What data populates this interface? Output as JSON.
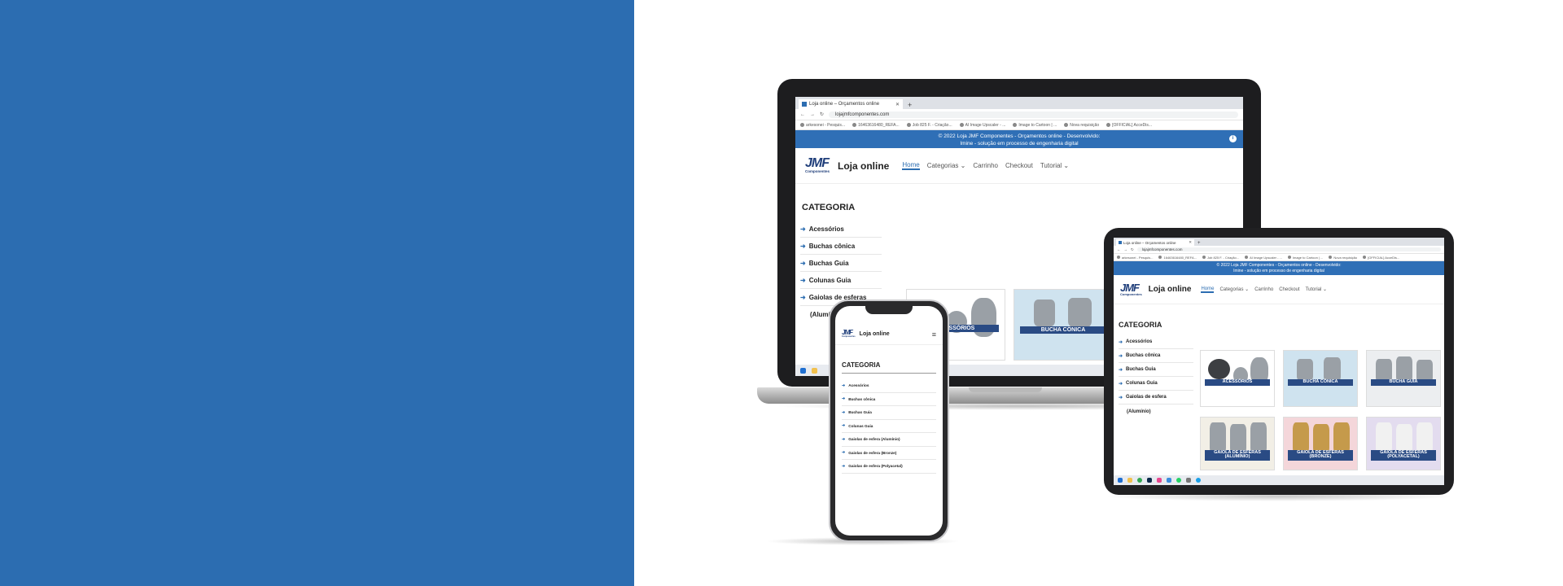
{
  "browser": {
    "tab_title": "Loja online – Orçamentos online",
    "tab_close": "✕",
    "new_tab": "+",
    "url": "lojajmfcomponentes.com",
    "bookmarks": [
      "arkesonei - Pesquis...",
      "16463616480_REFA...",
      "Job 825 F. - Criação...",
      "AI Image Upscaler - ...",
      "Image to Cartoon | ...",
      "Nova requisição",
      "[OFFICIAL] AcceDis..."
    ]
  },
  "site": {
    "banner_line1": "© 2022 Loja JMF Componentes - Orçamentos online - Desenvolvido:",
    "banner_line2": "Imine - solução em processo de engenharia digital",
    "banner_icon": "i",
    "logo_mark": "JMF",
    "logo_sub": "Componentes",
    "title": "Loja online",
    "menu": [
      "Home",
      "Categorias ⌄",
      "Carrinho",
      "Checkout",
      "Tutorial ⌄"
    ],
    "hamburger": "≡",
    "category_heading": "CATEGORIA",
    "categories_laptop": [
      "Acessórios",
      "Buchas cônica",
      "Buchas Guia",
      "Colunas Guia",
      "Gaiolas de esferas",
      "(Alumínio)"
    ],
    "categories_tablet": [
      "Acessórios",
      "Buchas cônica",
      "Buchas Guia",
      "Colunas Guia",
      "Gaiolas de esfera",
      "(Alumínio)"
    ],
    "categories_phone": [
      "Acessórios",
      "Buchas cônica",
      "Buchas Guia",
      "Colunas Guia",
      "Gaiolas de esfera (Alumínio)",
      "Gaiolas de esfera (Bronze)",
      "Gaiolas de esfera (Polyacetal)"
    ],
    "tiles_laptop": [
      "ACESSÓRIOS",
      "BUCHA CÔNICA",
      "GAIOLA DE ESFERAS (ALUMÍNIO)",
      "GAIOLA DE ESFERAS (BRONZE)"
    ],
    "tiles_tablet": [
      "ACESSÓRIOS",
      "BUCHA CÔNICA",
      "BUCHA GUIA",
      "GAIOLA DE ESFERAS (ALUMÍNIO)",
      "GAIOLA DE ESFERAS (BRONZE)",
      "GAIOLA DE ESFERAS (POLYACETAL)"
    ]
  },
  "colors": {
    "brand_blue": "#2c6db1",
    "label_navy": "#2a4b84",
    "tile_light_blue": "#cfe3ef",
    "tile_pink": "#f4d6da",
    "tile_lavender": "#e3dcef",
    "tile_light_gray": "#eceef0"
  }
}
